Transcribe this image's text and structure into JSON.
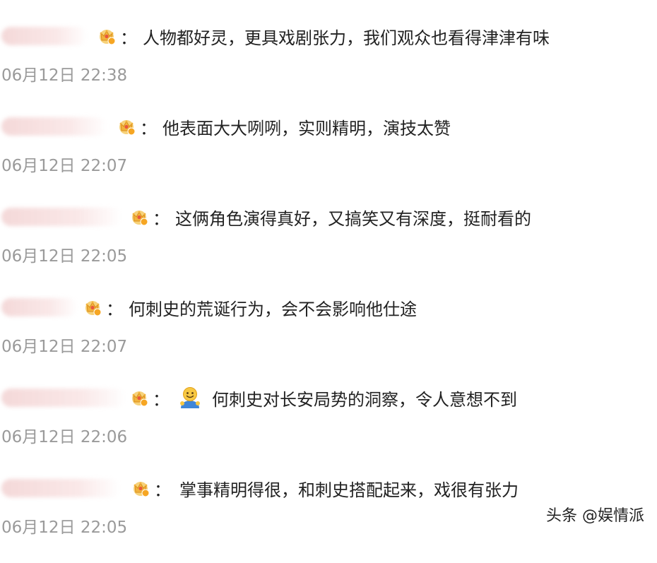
{
  "comments": [
    {
      "badge_level": "4",
      "text": "人物都好灵，更具戏剧张力，我们观众也看得津津有味",
      "time": "06月12日 22:38"
    },
    {
      "badge_level": "5",
      "text": "他表面大大咧咧，实则精明，演技太赞",
      "time": "06月12日 22:07"
    },
    {
      "badge_level": "6",
      "text": "这俩角色演得真好，又搞笑又有深度，挺耐看的",
      "time": "06月12日 22:05"
    },
    {
      "badge_level": "5",
      "text": "何刺史的荒诞行为，会不会影响他仕途",
      "time": "06月12日 22:07"
    },
    {
      "badge_level": "6",
      "text": "何刺史对长安局势的洞察，令人意想不到",
      "time": "06月12日 22:06",
      "emoji": "smiley-figure-icon"
    },
    {
      "badge_level": "6",
      "text": "掌事精明得很，和刺史搭配起来，戏很有张力",
      "time": "06月12日 22:05"
    }
  ],
  "colon": "：",
  "watermark": "头条 @娱情派",
  "colors": {
    "text": "#222222",
    "timestamp": "#9a9a9a",
    "badge_gold": "#f2b33d",
    "badge_gem": "#e8583c",
    "username_blur": "#ebb9b9"
  }
}
